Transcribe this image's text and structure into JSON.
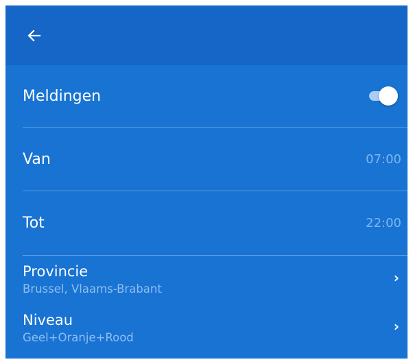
{
  "appbar": {
    "back_icon": "arrow-left-icon"
  },
  "settings": {
    "notifications": {
      "label": "Meldingen",
      "enabled": true
    },
    "from": {
      "label": "Van",
      "value": "07:00"
    },
    "to": {
      "label": "Tot",
      "value": "22:00"
    },
    "province": {
      "label": "Provincie",
      "value": "Brussel,  Vlaams-Brabant"
    },
    "level": {
      "label": "Niveau",
      "value": "Geel+Oranje+Rood"
    }
  },
  "colors": {
    "background": "#1873d3",
    "appbar": "#1566c6",
    "muted_text": "#7fb5ec"
  }
}
